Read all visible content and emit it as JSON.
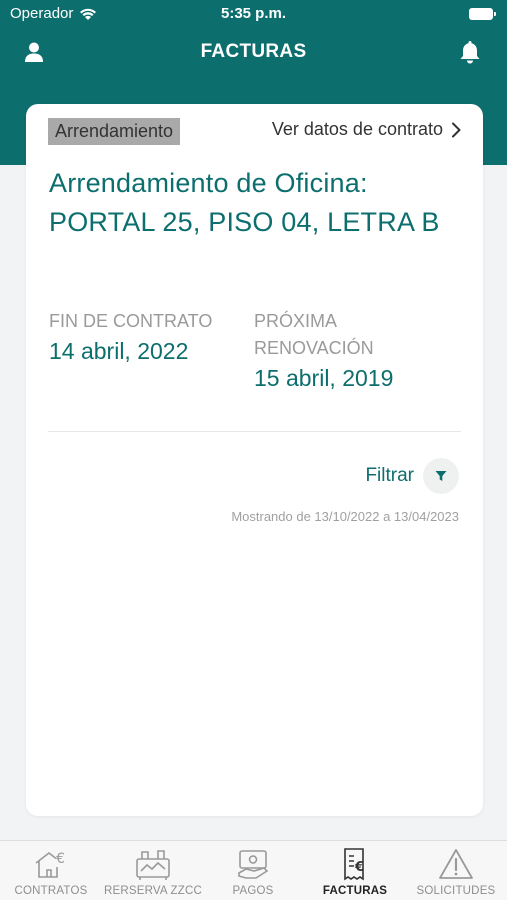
{
  "status_bar": {
    "carrier": "Operador",
    "time": "5:35 p.m."
  },
  "nav": {
    "title": "FACTURAS",
    "left_icon": "user-icon",
    "right_icon": "bell-icon"
  },
  "card": {
    "chip": "Arrendamiento",
    "contract_link": "Ver datos de contrato",
    "title": "Arrendamiento de Oficina: PORTAL 25, PISO 04, LETRA B",
    "end_label": "FIN DE CONTRATO",
    "end_value": "14 abril, 2022",
    "renewal_label": "PRÓXIMA RENOVACIÓN",
    "renewal_value": "15 abril, 2019",
    "filter_label": "Filtrar",
    "showing_text": "Mostrando de 13/10/2022 a 13/04/2023"
  },
  "tabs": [
    {
      "label": "CONTRATOS",
      "icon": "house-euro-icon",
      "active": false
    },
    {
      "label": "RERSERVA ZZCC",
      "icon": "facilities-icon",
      "active": false
    },
    {
      "label": "PAGOS",
      "icon": "payment-icon",
      "active": false
    },
    {
      "label": "FACTURAS",
      "icon": "invoice-icon",
      "active": true
    },
    {
      "label": "SOLICITUDES",
      "icon": "warning-icon",
      "active": false
    }
  ],
  "colors": {
    "primary": "#0d6e6e",
    "background": "#f2f3f5",
    "chip": "#a9a9a9"
  }
}
